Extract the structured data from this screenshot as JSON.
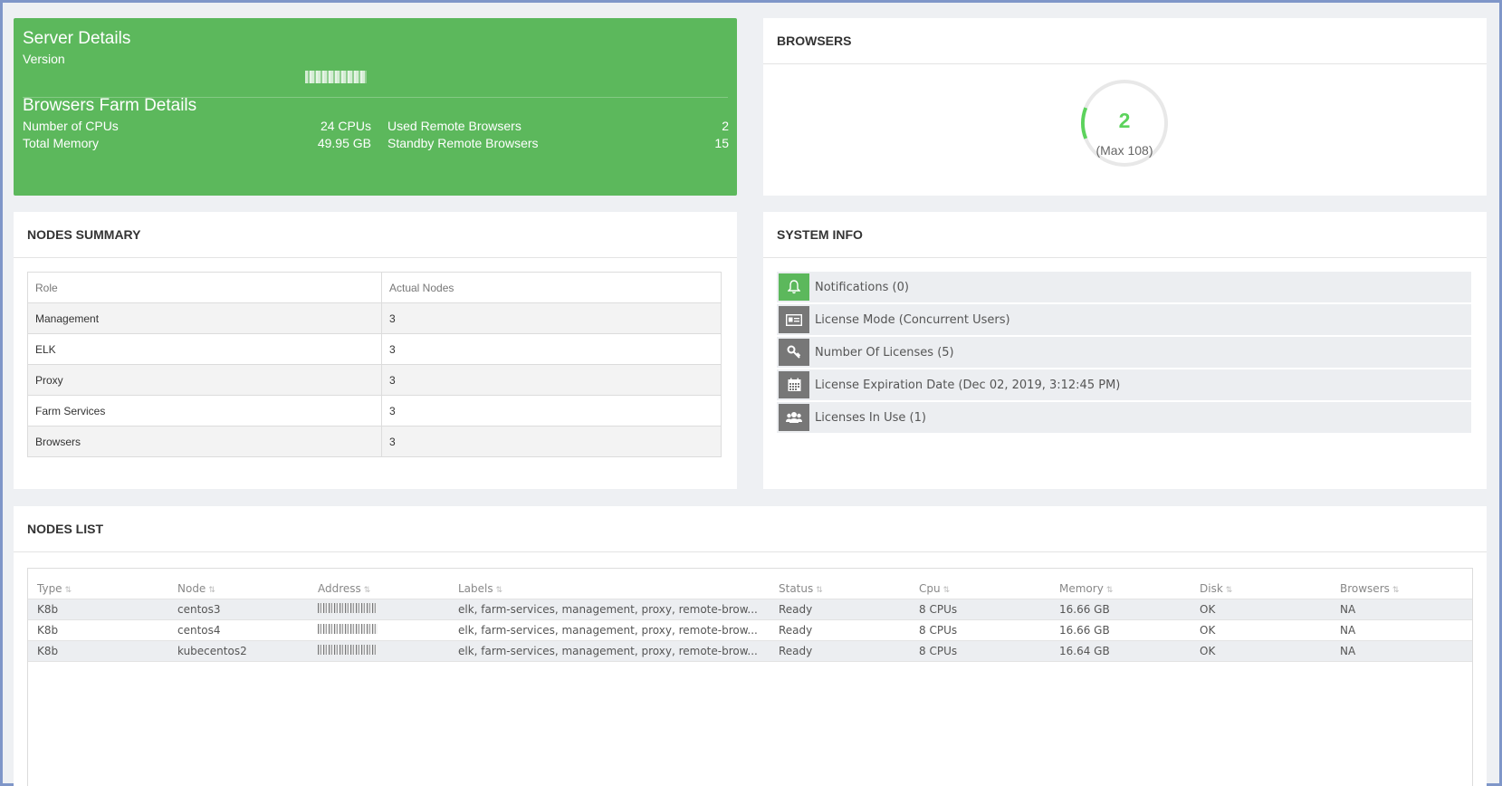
{
  "server": {
    "title": "Server Details",
    "version_label": "Version",
    "farm_title": "Browsers Farm Details",
    "cpus_label": "Number of CPUs",
    "cpus_value": "24 CPUs",
    "memory_label": "Total Memory",
    "memory_value": "49.95 GB",
    "used_label": "Used Remote Browsers",
    "used_value": "2",
    "standby_label": "Standby Remote Browsers",
    "standby_value": "15"
  },
  "browsers": {
    "title": "BROWSERS",
    "count": "2",
    "max": "(Max 108)",
    "fraction": 0.0185,
    "gauge_color": "#5cd35c"
  },
  "summary": {
    "title": "NODES SUMMARY",
    "headers": [
      "Role",
      "Actual Nodes"
    ],
    "rows": [
      [
        "Management",
        "3"
      ],
      [
        "ELK",
        "3"
      ],
      [
        "Proxy",
        "3"
      ],
      [
        "Farm Services",
        "3"
      ],
      [
        "Browsers",
        "3"
      ]
    ]
  },
  "sysinfo": {
    "title": "SYSTEM INFO",
    "items": [
      {
        "label": "Notifications (0)",
        "icon": "bell-icon"
      },
      {
        "label": "License Mode (Concurrent Users)",
        "icon": "id-card-icon"
      },
      {
        "label": "Number Of Licenses (5)",
        "icon": "key-icon"
      },
      {
        "label": "License Expiration Date (Dec 02, 2019, 3:12:45 PM)",
        "icon": "calendar-icon"
      },
      {
        "label": "Licenses In Use (1)",
        "icon": "users-icon"
      }
    ]
  },
  "nodes": {
    "title": "NODES LIST",
    "headers": [
      "Type",
      "Node",
      "Address",
      "Labels",
      "Status",
      "Cpu",
      "Memory",
      "Disk",
      "Browsers"
    ],
    "rows": [
      {
        "type": "K8b",
        "node": "centos3",
        "labels": "elk, farm-services, management, proxy, remote-brow...",
        "status": "Ready",
        "cpu": "8 CPUs",
        "memory": "16.66 GB",
        "disk": "OK",
        "browsers": "NA"
      },
      {
        "type": "K8b",
        "node": "centos4",
        "labels": "elk, farm-services, management, proxy, remote-brow...",
        "status": "Ready",
        "cpu": "8 CPUs",
        "memory": "16.66 GB",
        "disk": "OK",
        "browsers": "NA"
      },
      {
        "type": "K8b",
        "node": "kubecentos2",
        "labels": "elk, farm-services, management, proxy, remote-brow...",
        "status": "Ready",
        "cpu": "8 CPUs",
        "memory": "16.64 GB",
        "disk": "OK",
        "browsers": "NA"
      }
    ]
  }
}
